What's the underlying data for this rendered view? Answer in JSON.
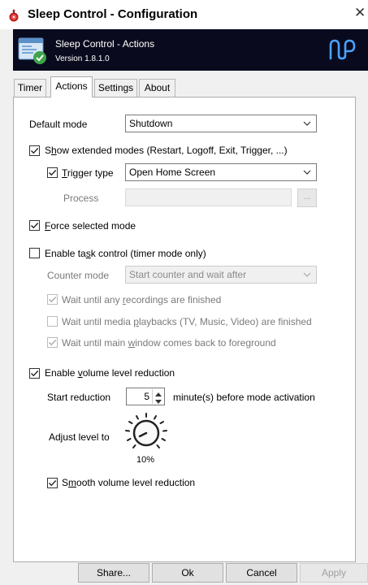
{
  "window": {
    "title": "Sleep Control - Configuration"
  },
  "banner": {
    "title": "Sleep Control - Actions",
    "version": "Version 1.8.1.0",
    "brand_color": "#0a0a1e"
  },
  "tabs": [
    {
      "label": "Timer",
      "active": false
    },
    {
      "label": "Actions",
      "active": true
    },
    {
      "label": "Settings",
      "active": false
    },
    {
      "label": "About",
      "active": false
    }
  ],
  "actions": {
    "default_mode": {
      "label": "Default mode",
      "value": "Shutdown"
    },
    "extended_modes": {
      "pre": "S",
      "key": "h",
      "post": "ow extended modes (Restart, Logoff, Exit, Trigger, ...)",
      "checked": true
    },
    "trigger_type": {
      "pre": "",
      "key": "T",
      "post": "rigger type",
      "checked": true,
      "value": "Open Home Screen"
    },
    "process": {
      "label": "Process",
      "value": "",
      "browse": "..."
    },
    "force_mode": {
      "pre": "",
      "key": "F",
      "post": "orce selected mode",
      "checked": true
    },
    "task_control": {
      "pre": "Enable ta",
      "key": "s",
      "post": "k control (timer mode only)",
      "checked": false
    },
    "counter_mode": {
      "label": "Counter mode",
      "value": "Start counter and wait after"
    },
    "wait_recordings": {
      "pre": "Wait until any ",
      "key": "r",
      "post": "ecordings are finished",
      "checked": true
    },
    "wait_playbacks": {
      "pre": "Wait until media ",
      "key": "p",
      "post": "laybacks (TV, Music, Video) are finished",
      "checked": false
    },
    "wait_window": {
      "pre": "Wait until main ",
      "key": "w",
      "post": "indow comes back to foreground",
      "checked": true
    },
    "volume_reduction": {
      "pre": "Enable ",
      "key": "v",
      "post": "olume level reduction",
      "checked": true
    },
    "start_reduction": {
      "label": "Start reduction",
      "value": "5",
      "suffix": "minute(s) before mode activation"
    },
    "adjust_level": {
      "label": "Adjust level to",
      "value": "10%",
      "level_percent": 10
    },
    "smooth_volume": {
      "pre": "S",
      "key": "m",
      "post": "ooth volume level reduction",
      "checked": true
    }
  },
  "footer": {
    "share": "Share...",
    "ok": "Ok",
    "cancel": "Cancel",
    "apply": "Apply"
  }
}
